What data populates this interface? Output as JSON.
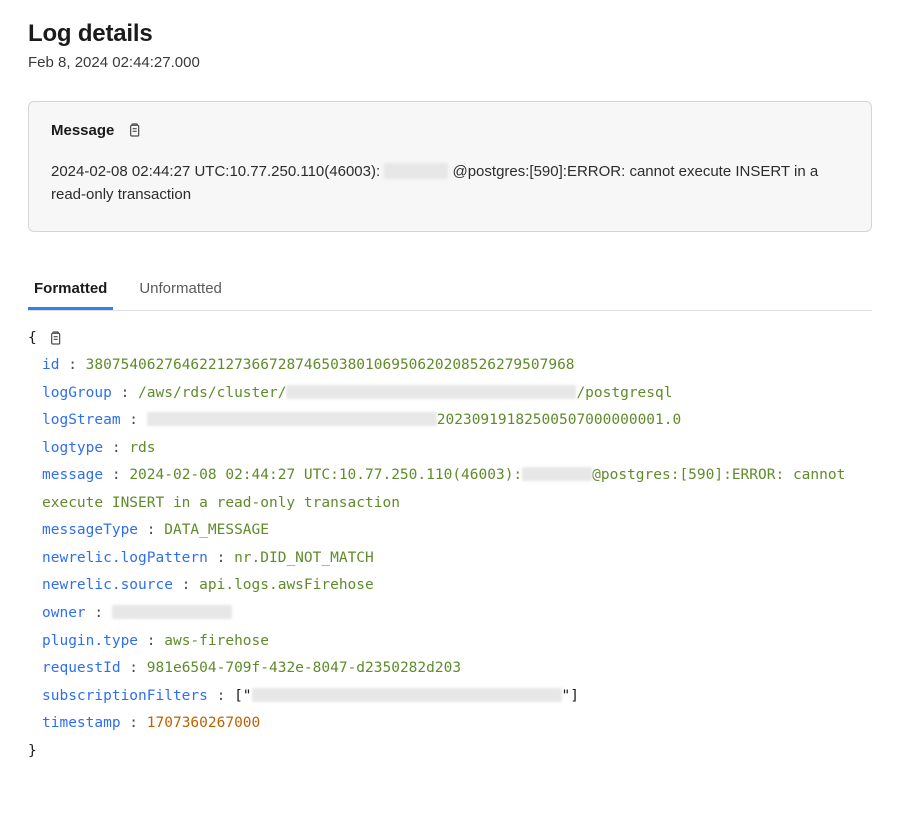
{
  "title": "Log details",
  "timestamp_display": "Feb 8, 2024 02:44:27.000",
  "message_section": {
    "header": "Message",
    "body_before_redaction": "2024-02-08 02:44:27 UTC:10.77.250.110(46003):",
    "body_after_redaction": "@postgres:[590]:ERROR:  cannot execute INSERT in a read-only transaction"
  },
  "tabs": {
    "formatted": "Formatted",
    "unformatted": "Unformatted"
  },
  "json_open": "{",
  "json_close": "}",
  "colon": " : ",
  "fields": {
    "id": {
      "key": "id",
      "value": "38075406276462212736672874650380106950620208526279507968",
      "type": "str"
    },
    "logGroup": {
      "key": "logGroup",
      "value_before": "/aws/rds/cluster/",
      "value_after": "/postgresql",
      "redacted_width": 290,
      "type": "str"
    },
    "logStream": {
      "key": "logStream",
      "value_before": "",
      "value_after": "20230919182500507000000001.0",
      "redacted_width": 290,
      "type": "str"
    },
    "logtype": {
      "key": "logtype",
      "value": "rds",
      "type": "str"
    },
    "message": {
      "key": "message",
      "value_before": "2024-02-08 02:44:27 UTC:10.77.250.110(46003):",
      "value_after": "@postgres:[590]:ERROR:  cannot execute INSERT in a read-only transaction",
      "redacted_width": 70,
      "type": "str"
    },
    "messageType": {
      "key": "messageType",
      "value": "DATA_MESSAGE",
      "type": "str"
    },
    "newrelic_logPattern": {
      "key": "newrelic.logPattern",
      "value": "nr.DID_NOT_MATCH",
      "type": "str"
    },
    "newrelic_source": {
      "key": "newrelic.source",
      "value": "api.logs.awsFirehose",
      "type": "str"
    },
    "owner": {
      "key": "owner",
      "value_before": "",
      "value_after": "",
      "redacted_width": 120,
      "type": "str"
    },
    "plugin_type": {
      "key": "plugin.type",
      "value": "aws-firehose",
      "type": "str"
    },
    "requestId": {
      "key": "requestId",
      "value": "981e6504-709f-432e-8047-d2350282d203",
      "type": "str"
    },
    "subscriptionFilters": {
      "key": "subscriptionFilters",
      "value_before": "[\"",
      "value_after": "\"]",
      "redacted_width": 310,
      "type": "black"
    },
    "timestamp": {
      "key": "timestamp",
      "value": "1707360267000",
      "type": "num"
    }
  }
}
